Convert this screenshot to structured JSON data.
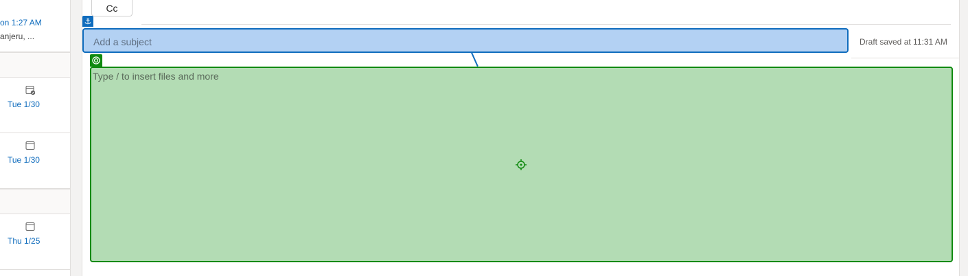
{
  "message_list": {
    "items": [
      {
        "time": "on 1:27 AM",
        "from": "anjeru, ..."
      },
      {
        "date": "Tue 1/30",
        "icon": "calendar-check-icon"
      },
      {
        "date": "Tue 1/30",
        "icon": "calendar-icon"
      },
      {
        "date": "Thu 1/25",
        "icon": "calendar-icon"
      }
    ]
  },
  "compose": {
    "cc_label": "Cc",
    "subject_placeholder": "Add a subject",
    "draft_status": "Draft saved at 11:31 AM",
    "body_placeholder": "Type / to insert files and more"
  },
  "overlay": {
    "anchor_glyph": "⚓",
    "subject_highlight_color": "#b3d1f3",
    "body_highlight_color": "#b3dcb4",
    "subject_border_color": "#0f6cbd",
    "body_border_color": "#108a10"
  }
}
